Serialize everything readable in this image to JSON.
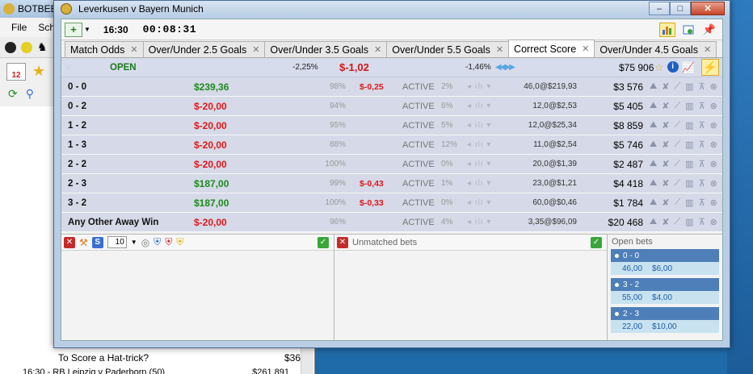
{
  "background_app": {
    "title": "BOTBEE",
    "menu": [
      "File",
      "Sch"
    ],
    "footer_item": "To Score a Hat-trick?",
    "footer_value": "$36",
    "footer_match": "16:30 - RB Leipzig v Paderborn (50)",
    "footer_match_value": "$261 891"
  },
  "window": {
    "title": "Leverkusen v Bayern Munich",
    "controls": {
      "minimize": "–",
      "maximize": "□",
      "close": "✕"
    }
  },
  "topbar": {
    "start_time": "16:30",
    "countdown": "00:08:31"
  },
  "tabs": [
    {
      "label": "Match Odds",
      "selected": false
    },
    {
      "label": "Over/Under 2.5 Goals",
      "selected": false
    },
    {
      "label": "Over/Under 3.5 Goals",
      "selected": false
    },
    {
      "label": "Over/Under 5.5 Goals",
      "selected": false
    },
    {
      "label": "Correct Score",
      "selected": true
    },
    {
      "label": "Over/Under 4.5 Goals",
      "selected": false
    }
  ],
  "market": {
    "status": "OPEN",
    "back_pct": "-2,25%",
    "profit_loss": "$-1,02",
    "lay_pct": "-1,46%",
    "matched": "$75 906"
  },
  "runners": [
    {
      "name": "0 - 0",
      "pl": "$239,36",
      "pl_sign": "pos",
      "pct": "98%",
      "sub": "$-0,25",
      "status": "ACTIVE",
      "spct": "2%",
      "odds": "46,0@$219,93",
      "stake": "$3 576"
    },
    {
      "name": "0 - 2",
      "pl": "$-20,00",
      "pl_sign": "neg",
      "pct": "94%",
      "sub": "",
      "status": "ACTIVE",
      "spct": "6%",
      "odds": "12,0@$2,53",
      "stake": "$5 405"
    },
    {
      "name": "1 - 2",
      "pl": "$-20,00",
      "pl_sign": "neg",
      "pct": "95%",
      "sub": "",
      "status": "ACTIVE",
      "spct": "5%",
      "odds": "12,0@$25,34",
      "stake": "$8 859"
    },
    {
      "name": "1 - 3",
      "pl": "$-20,00",
      "pl_sign": "neg",
      "pct": "88%",
      "sub": "",
      "status": "ACTIVE",
      "spct": "12%",
      "odds": "11,0@$2,54",
      "stake": "$5 746"
    },
    {
      "name": "2 - 2",
      "pl": "$-20,00",
      "pl_sign": "neg",
      "pct": "100%",
      "sub": "",
      "status": "ACTIVE",
      "spct": "0%",
      "odds": "20,0@$1,39",
      "stake": "$2 487"
    },
    {
      "name": "2 - 3",
      "pl": "$187,00",
      "pl_sign": "pos",
      "pct": "99%",
      "sub": "$-0,43",
      "status": "ACTIVE",
      "spct": "1%",
      "odds": "23,0@$1,21",
      "stake": "$4 418"
    },
    {
      "name": "3 - 2",
      "pl": "$187,00",
      "pl_sign": "pos",
      "pct": "100%",
      "sub": "$-0,33",
      "status": "ACTIVE",
      "spct": "0%",
      "odds": "60,0@$0,46",
      "stake": "$1 784"
    },
    {
      "name": "Any Other Away Win",
      "pl": "$-20,00",
      "pl_sign": "neg",
      "pct": "96%",
      "sub": "",
      "status": "ACTIVE",
      "spct": "4%",
      "odds": "3,35@$96,09",
      "stake": "$20 468"
    }
  ],
  "bet_panel": {
    "stake_value": "10",
    "unmatched_title": "Unmatched bets",
    "open_title": "Open bets"
  },
  "open_bets": [
    {
      "selection": "0 - 0",
      "odds": "46,00",
      "stake": "$6,00"
    },
    {
      "selection": "3 - 2",
      "odds": "55,00",
      "stake": "$4,00"
    },
    {
      "selection": "2 - 3",
      "odds": "22,00",
      "stake": "$10,00"
    }
  ],
  "colors": {
    "positive": "#1b8a1b",
    "negative": "#e01818",
    "row_bg": "#d5d9e8",
    "open_bet_head": "#4e7fb8",
    "open_bet_body": "#c8e2f0"
  }
}
